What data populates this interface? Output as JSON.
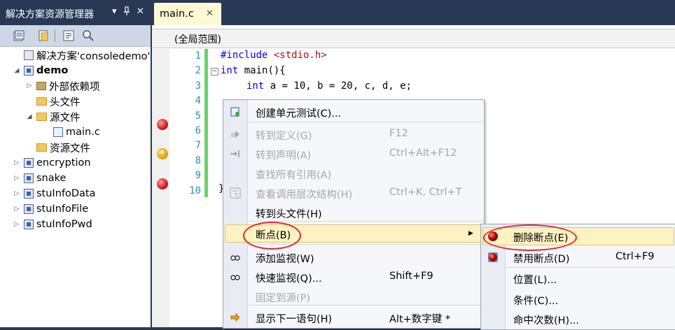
{
  "solution_explorer": {
    "title": "解决方案资源管理器",
    "pin_glyph": "▾",
    "pin2_glyph": "ꟷ",
    "close_glyph": "✕",
    "toolbar_icons": [
      "properties-icon",
      "show-all-files-icon",
      "class-view-icon",
      "search-icon"
    ],
    "tree": [
      {
        "label": "解决方案'consoledemo'",
        "icon": "solution-icon",
        "level": 0,
        "expanded": null
      },
      {
        "label": "demo",
        "icon": "project-icon",
        "level": 0,
        "expanded": true,
        "bold": true
      },
      {
        "label": "外部依赖项",
        "icon": "references-icon",
        "level": 1,
        "expanded": false
      },
      {
        "label": "头文件",
        "icon": "folder-icon",
        "level": 1,
        "expanded": null
      },
      {
        "label": "源文件",
        "icon": "folder-open-icon",
        "level": 1,
        "expanded": true
      },
      {
        "label": "main.c",
        "icon": "c-file-icon",
        "level": 2,
        "expanded": null
      },
      {
        "label": "资源文件",
        "icon": "folder-icon",
        "level": 1,
        "expanded": null
      },
      {
        "label": "encryption",
        "icon": "project-icon",
        "level": 0,
        "expanded": false
      },
      {
        "label": "snake",
        "icon": "project-icon",
        "level": 0,
        "expanded": false
      },
      {
        "label": "stuInfoData",
        "icon": "project-icon",
        "level": 0,
        "expanded": false
      },
      {
        "label": "stuInfoFile",
        "icon": "project-icon",
        "level": 0,
        "expanded": false
      },
      {
        "label": "stuInfoPwd",
        "icon": "project-icon",
        "level": 0,
        "expanded": false
      }
    ]
  },
  "editor": {
    "tab_label": "main.c",
    "tab_close": "✕",
    "scope_label": "(全局范围)",
    "line_numbers": [
      "1",
      "2",
      "3",
      "4",
      "5",
      "6",
      "7",
      "8",
      "9",
      "10"
    ],
    "code_line1_directive": "#include",
    "code_line1_header": "<stdio.h>",
    "code_line2_kw": "int",
    "code_line2_rest": " main(){",
    "code_line3_kw": "int",
    "code_line3_rest": " a = 10, b = 20, c, d, e;",
    "collapse_glyph": "−",
    "line10_stub": "}",
    "breakpoint_lines": [
      4,
      8
    ],
    "current_line": 6
  },
  "context_menu": {
    "items": [
      {
        "label": "创建单元测试(C)...",
        "shortcut": "",
        "icon": "unit-test-icon",
        "disabled": false
      },
      {
        "label": "转到定义(G)",
        "shortcut": "F12",
        "icon": "go-to-definition-icon",
        "disabled": true
      },
      {
        "label": "转到声明(A)",
        "shortcut": "Ctrl+Alt+F12",
        "icon": "go-to-declaration-icon",
        "disabled": true
      },
      {
        "label": "查找所有引用(A)",
        "shortcut": "",
        "icon": "",
        "disabled": true
      },
      {
        "label": "查看调用层次结构(H)",
        "shortcut": "Ctrl+K, Ctrl+T",
        "icon": "call-hierarchy-icon",
        "disabled": true
      },
      {
        "label": "转到头文件(H)",
        "shortcut": "",
        "icon": "",
        "disabled": false
      },
      {
        "label": "断点(B)",
        "shortcut": "",
        "icon": "",
        "disabled": false,
        "submenu": true,
        "highlighted": true
      },
      {
        "label": "添加监视(W)",
        "shortcut": "",
        "icon": "watch-icon",
        "disabled": false
      },
      {
        "label": "快速监视(Q)...",
        "shortcut": "Shift+F9",
        "icon": "quick-watch-icon",
        "disabled": false
      },
      {
        "label": "固定到源(P)",
        "shortcut": "",
        "icon": "",
        "disabled": true
      },
      {
        "label": "显示下一语句(H)",
        "shortcut": "Alt+数字键 *",
        "icon": "next-statement-icon",
        "disabled": false
      }
    ],
    "submenu_arrow": "▶"
  },
  "breakpoint_submenu": {
    "items": [
      {
        "label": "删除断点(E)",
        "shortcut": "",
        "icon": "breakpoint-icon",
        "highlighted": true
      },
      {
        "label": "禁用断点(D)",
        "shortcut": "Ctrl+F9",
        "icon": "disable-breakpoint-icon"
      },
      {
        "label": "位置(L)...",
        "shortcut": "",
        "icon": ""
      },
      {
        "label": "条件(C)...",
        "shortcut": "",
        "icon": ""
      },
      {
        "label": "命中次数(H)...",
        "shortcut": "",
        "icon": ""
      }
    ]
  },
  "colors": {
    "chrome": "#293955",
    "tab_active": "#fff9d6",
    "menu_highlight": "#fdf2c2",
    "annotation_red": "#e8242a",
    "edit_bar_green": "#6ad36a"
  }
}
